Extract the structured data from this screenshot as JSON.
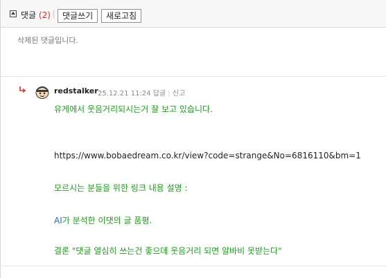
{
  "header": {
    "title": "댓글",
    "count": "(2)",
    "write_label": "댓글쓰기",
    "refresh_label": "새로고침"
  },
  "deleted_comment": {
    "text": "삭제된 댓글입니다."
  },
  "reply": {
    "author": "redstalker",
    "datetime": "25.12.21 11:24",
    "reply_label": "답글",
    "report_label": "신고",
    "lines": [
      "유게에서 웃음거리되시는거 잘 보고 있습니다.",
      "https://www.bobaedream.co.kr/view?code=strange&No=6816110&bm=1",
      "모르시는 분들을 위한 링크 내용 설명 :",
      "AI",
      "가 분석한 이댓의 글 품평.",
      "결론 \"댓글 열심히 쓰는건 좋으데 웃음거리 되면 알바비 못받는다\""
    ]
  },
  "colors": {
    "green_text": "#1a9e1a",
    "count_red": "#e0291f",
    "ai_blue": "#1a6edc"
  }
}
